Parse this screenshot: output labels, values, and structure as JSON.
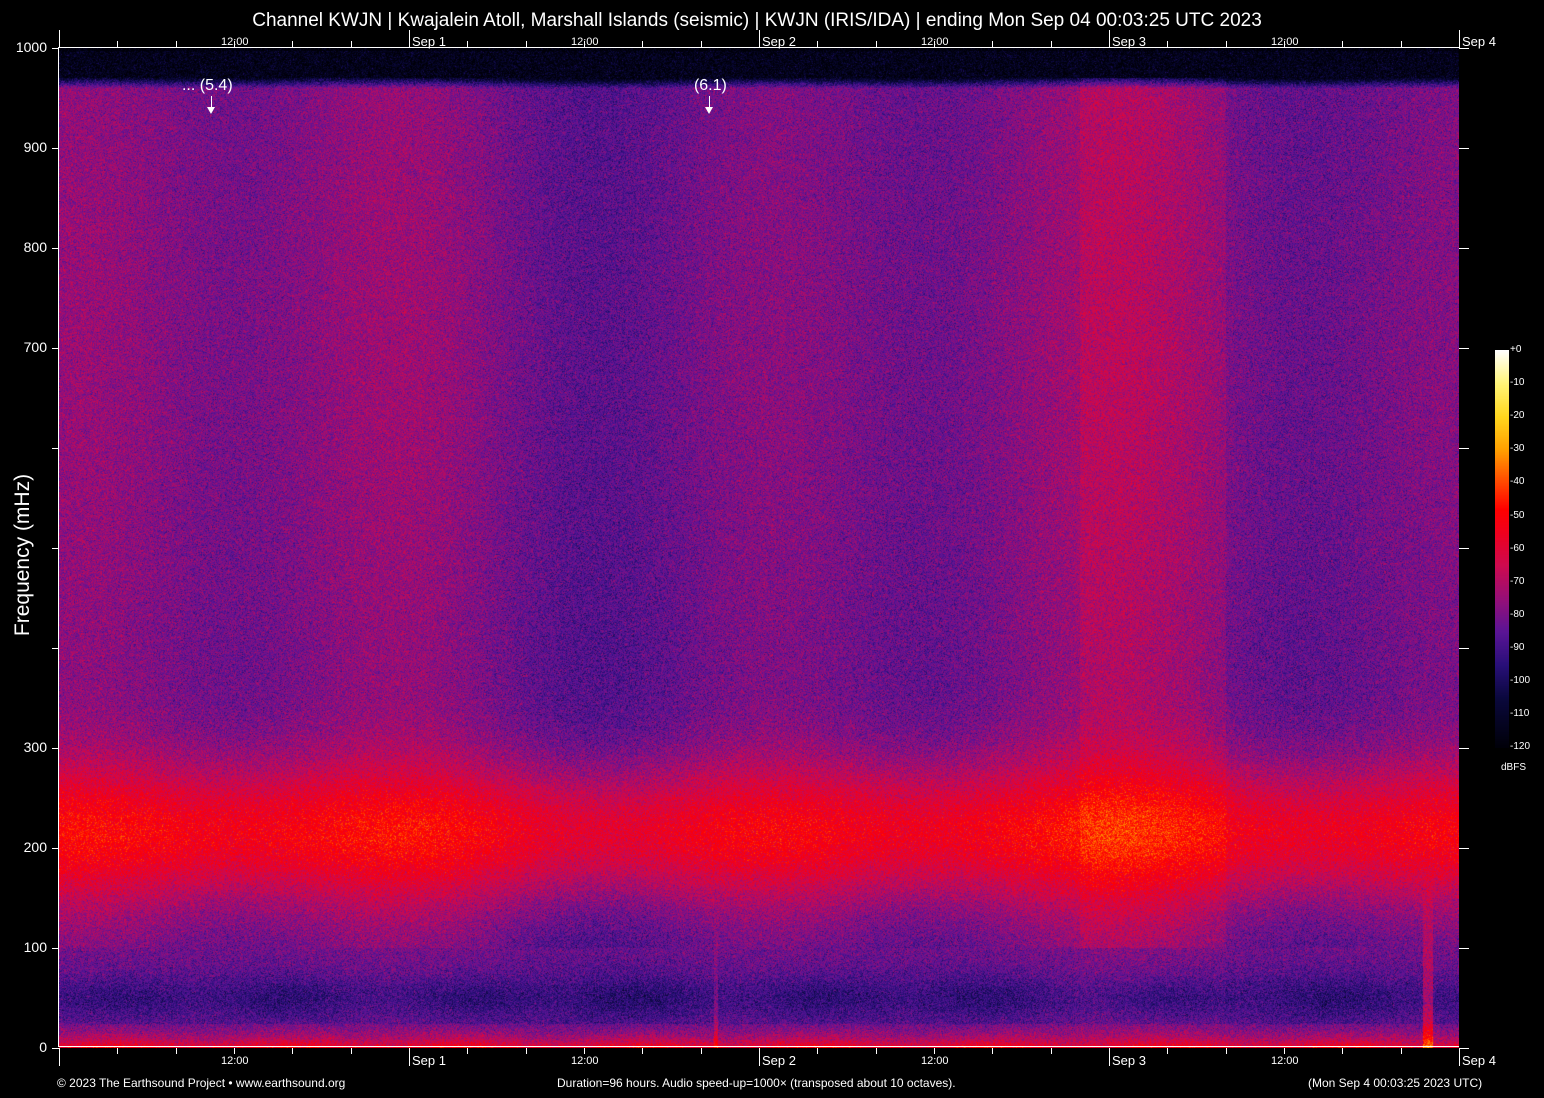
{
  "title": "Channel KWJN | Kwajalein Atoll, Marshall Islands (seismic) | KWJN (IRIS/IDA) | ending Mon Sep 04 00:03:25 UTC 2023",
  "footer": {
    "left": "© 2023 The Earthsound Project • www.earthsound.org",
    "center": "Duration=96 hours. Audio speed-up=1000× (transposed about 10 octaves).",
    "right": "(Mon Sep  4 00:03:25 2023 UTC)"
  },
  "colors": {
    "background": "#000000",
    "text": "#ffffff"
  },
  "chart_data": {
    "type": "heatmap",
    "title": "Channel KWJN | Kwajalein Atoll, Marshall Islands (seismic) | KWJN (IRIS/IDA) | ending Mon Sep 04 00:03:25 UTC 2023",
    "ylabel": "Frequency (mHz)",
    "xlabel": "",
    "ylim": [
      0,
      1000
    ],
    "xlim_hours": [
      0,
      96
    ],
    "y_ticks": [
      0,
      100,
      200,
      300,
      400,
      500,
      600,
      700,
      800,
      900,
      1000
    ],
    "y_tick_labels": [
      "0",
      "100",
      "200",
      "300",
      "",
      "",
      "",
      "700",
      "800",
      "900",
      "1000"
    ],
    "x_tick_step_hours": 4,
    "x_labels": [
      {
        "hour": 12,
        "label": "12:00",
        "day": false
      },
      {
        "hour": 24,
        "label": "Sep  1",
        "day": true
      },
      {
        "hour": 36,
        "label": "12:00",
        "day": false
      },
      {
        "hour": 48,
        "label": "Sep  2",
        "day": true
      },
      {
        "hour": 60,
        "label": "12:00",
        "day": false
      },
      {
        "hour": 72,
        "label": "Sep  3",
        "day": true
      },
      {
        "hour": 84,
        "label": "12:00",
        "day": false
      },
      {
        "hour": 96,
        "label": "Sep  4",
        "day": true
      }
    ],
    "events": [
      {
        "hour": 10.4,
        "label": "... (5.4)"
      },
      {
        "hour": 44.6,
        "label": "(6.1)"
      }
    ],
    "colorbar": {
      "unit": "dBFS",
      "range": [
        -120,
        0
      ],
      "ticks": [
        "+0",
        "-10",
        "-20",
        "-30",
        "-40",
        "-50",
        "-60",
        "-70",
        "-80",
        "-90",
        "-100",
        "-110",
        "-120"
      ]
    },
    "description_levels_dbfs": {
      "high_freq_background": -85,
      "band_200_mHz": -55,
      "below_20_mHz": -55,
      "microseism_gap_30_70_mHz": -95
    }
  }
}
